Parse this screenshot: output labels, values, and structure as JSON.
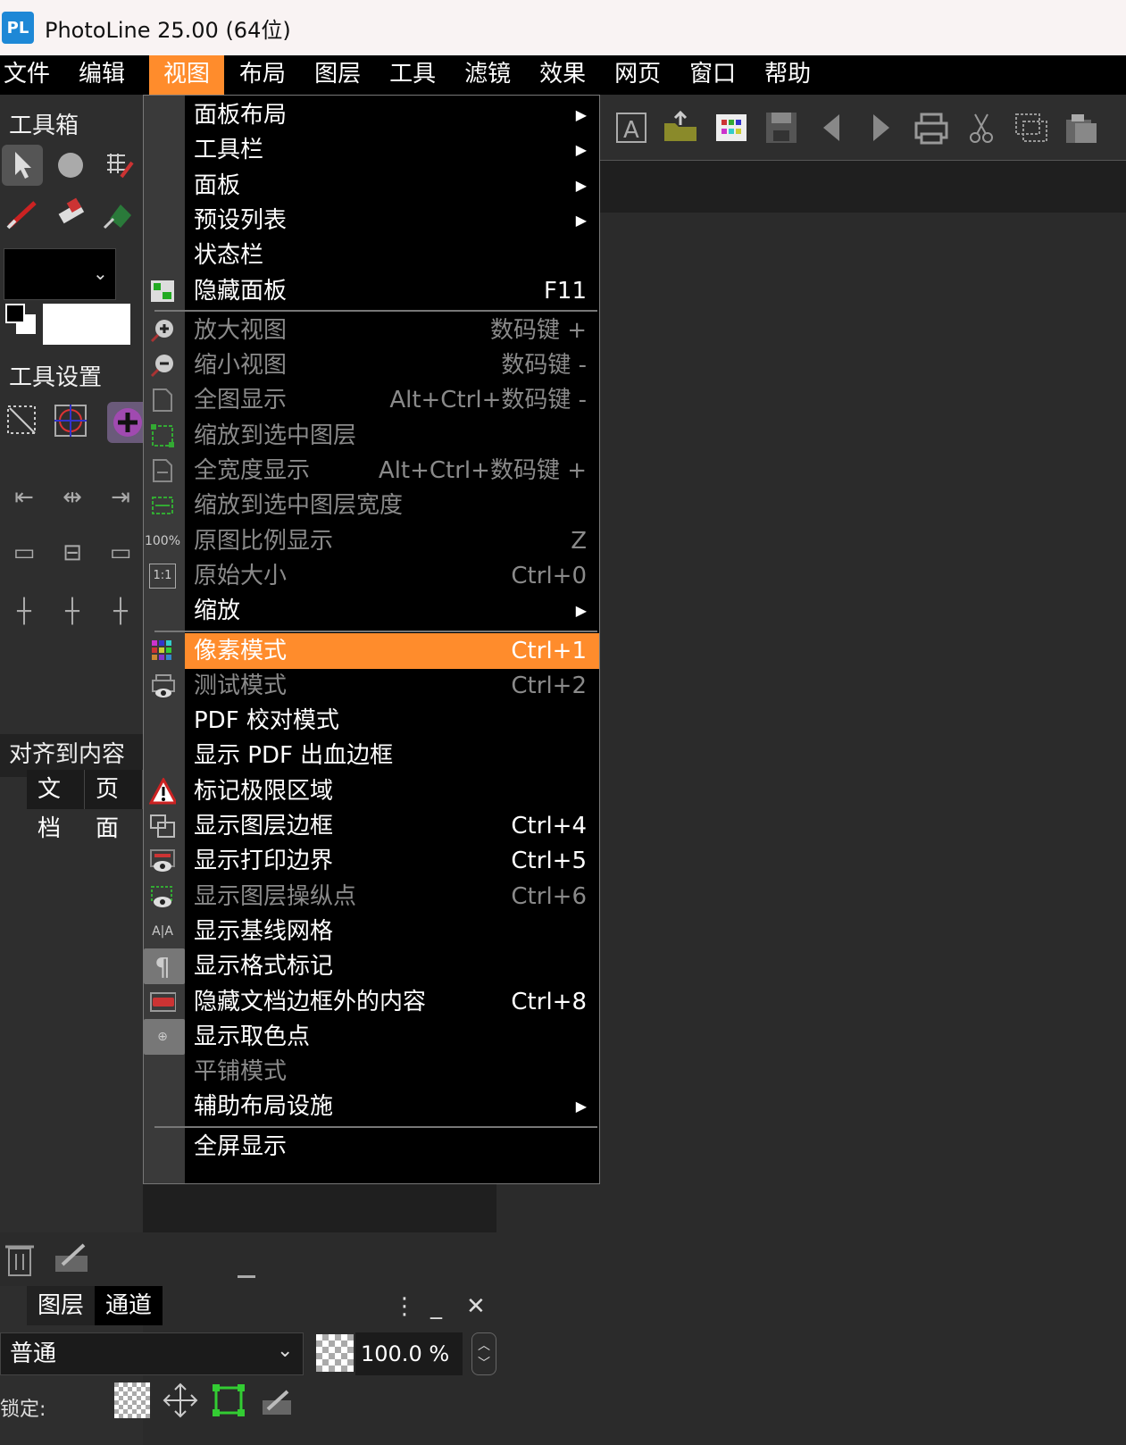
{
  "window": {
    "title": "PhotoLine 25.00 (64位)",
    "logo_text": "PL"
  },
  "menubar": [
    "文件",
    "编辑",
    "视图",
    "布局",
    "图层",
    "工具",
    "滤镜",
    "效果",
    "网页",
    "窗口",
    "帮助"
  ],
  "active_menu": "视图",
  "left": {
    "toolbox_title": "工具箱",
    "tool_settings_title": "工具设置",
    "align_label": "对齐到内容",
    "doc_tabs": [
      "文档",
      "页面"
    ]
  },
  "layers_panel": {
    "tabs": [
      "图层",
      "通道"
    ],
    "blend_mode": "普通",
    "opacity": "100.0 %",
    "lock_label": "锁定:"
  },
  "view_menu": [
    {
      "label": "面板布局",
      "submenu": true
    },
    {
      "label": "工具栏",
      "submenu": true
    },
    {
      "label": "面板",
      "submenu": true
    },
    {
      "label": "预设列表",
      "submenu": true
    },
    {
      "label": "状态栏"
    },
    {
      "label": "隐藏面板",
      "shortcut": "F11",
      "icon": "hide-panels-icon"
    },
    {
      "label": "放大视图",
      "shortcut": "数码键 +",
      "disabled": true,
      "icon": "zoom-in-icon"
    },
    {
      "label": "缩小视图",
      "shortcut": "数码键 -",
      "disabled": true,
      "icon": "zoom-out-icon"
    },
    {
      "label": "全图显示",
      "shortcut": "Alt+Ctrl+数码键 -",
      "disabled": true,
      "icon": "fit-page-icon"
    },
    {
      "label": "缩放到选中图层",
      "disabled": true,
      "icon": "fit-layer-icon"
    },
    {
      "label": "全宽度显示",
      "shortcut": "Alt+Ctrl+数码键 +",
      "disabled": true,
      "icon": "fit-width-icon"
    },
    {
      "label": "缩放到选中图层宽度",
      "disabled": true,
      "icon": "fit-layer-width-icon"
    },
    {
      "label": "原图比例显示",
      "shortcut": "Z",
      "disabled": true,
      "icon": "actual-pixels-icon",
      "icon_text": "100%"
    },
    {
      "label": "原始大小",
      "shortcut": "Ctrl+0",
      "disabled": true,
      "icon": "original-size-icon",
      "icon_text": "1:1"
    },
    {
      "label": "缩放",
      "submenu": true
    },
    {
      "label": "像素模式",
      "shortcut": "Ctrl+1",
      "highlight": true,
      "icon": "pixel-mode-icon"
    },
    {
      "label": "测试模式",
      "shortcut": "Ctrl+2",
      "disabled": true,
      "icon": "proof-mode-icon"
    },
    {
      "label": "PDF 校对模式"
    },
    {
      "label": "显示 PDF 出血边框"
    },
    {
      "label": "标记极限区域",
      "icon": "warning-icon"
    },
    {
      "label": "显示图层边框",
      "shortcut": "Ctrl+4",
      "icon": "layer-bounds-icon"
    },
    {
      "label": "显示打印边界",
      "shortcut": "Ctrl+5",
      "icon": "print-bounds-icon"
    },
    {
      "label": "显示图层操纵点",
      "shortcut": "Ctrl+6",
      "disabled": true,
      "icon": "layer-handles-icon"
    },
    {
      "label": "显示基线网格",
      "icon": "baseline-grid-icon",
      "icon_text": "A|A"
    },
    {
      "label": "显示格式标记",
      "icon": "pilcrow-icon",
      "icon_text": "¶",
      "checked": true
    },
    {
      "label": "隐藏文档边框外的内容",
      "shortcut": "Ctrl+8",
      "icon": "hide-outside-icon"
    },
    {
      "label": "显示取色点",
      "icon": "color-sampler-icon",
      "icon_text": "⊕",
      "checked": true
    },
    {
      "label": "平铺模式",
      "disabled": true
    },
    {
      "label": "辅助布局设施",
      "submenu": true
    },
    {
      "label": "全屏显示"
    }
  ],
  "colors": {
    "accent": "#ff8c2c",
    "menu_bg": "#000000",
    "disabled_text": "#8a8a8a"
  }
}
